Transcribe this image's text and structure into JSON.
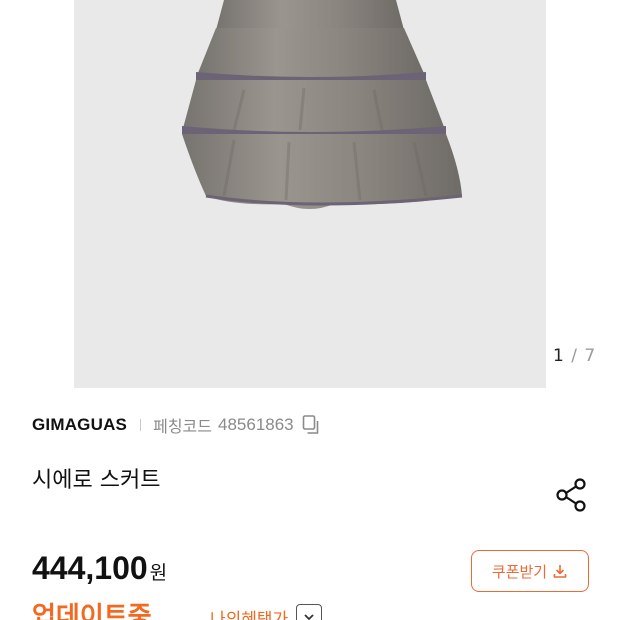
{
  "gallery": {
    "current": "1",
    "separator": "/",
    "total": "7",
    "image_alt": "grey tiered skirt product photo"
  },
  "product": {
    "brand": "GIMAGUAS",
    "code_label": "페칭코드",
    "code_value": "48561863",
    "title": "시에로 스커트",
    "price": "444,100",
    "currency": "원"
  },
  "actions": {
    "coupon_label": "쿠폰받기",
    "benefit_label": "나의혜택가"
  },
  "promo": {
    "text": "업데이트중"
  },
  "icons": [
    "copy-icon",
    "share-icon",
    "download-icon",
    "chevron-down-icon"
  ],
  "colors": {
    "accent": "#ea6b35",
    "promo": "#f26a21",
    "photo_bg": "#e9e9e9",
    "skirt": "#8a8580"
  }
}
